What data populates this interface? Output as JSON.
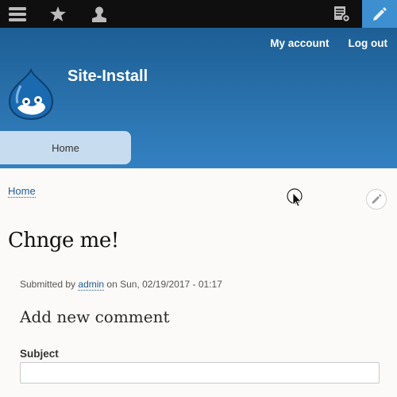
{
  "toolbar": {
    "icons": {
      "menu": "hamburger-icon",
      "shortcuts": "star-icon",
      "user": "user-icon",
      "tasks": "tasks-icon",
      "edit": "pencil-icon"
    },
    "colors": {
      "background": "#0f0f0f",
      "active": "#3d8fd0"
    }
  },
  "header": {
    "links": {
      "my_account": "My account",
      "log_out": "Log out"
    },
    "site_name": "Site-Install",
    "logo": "drupal-drop-logo",
    "nav": {
      "home": "Home"
    },
    "colors": {
      "top": "#1d5e95",
      "bottom": "#3381c2",
      "tab": "#c8dcef"
    }
  },
  "main": {
    "breadcrumb": {
      "home": "Home"
    },
    "title": "Chnge me!",
    "meta": {
      "prefix": "Submitted by",
      "author": "admin",
      "date": "on Sun, 02/19/2017 - 01:17"
    },
    "comment_form": {
      "heading": "Add new comment",
      "subject_label": "Subject",
      "subject_value": ""
    }
  }
}
